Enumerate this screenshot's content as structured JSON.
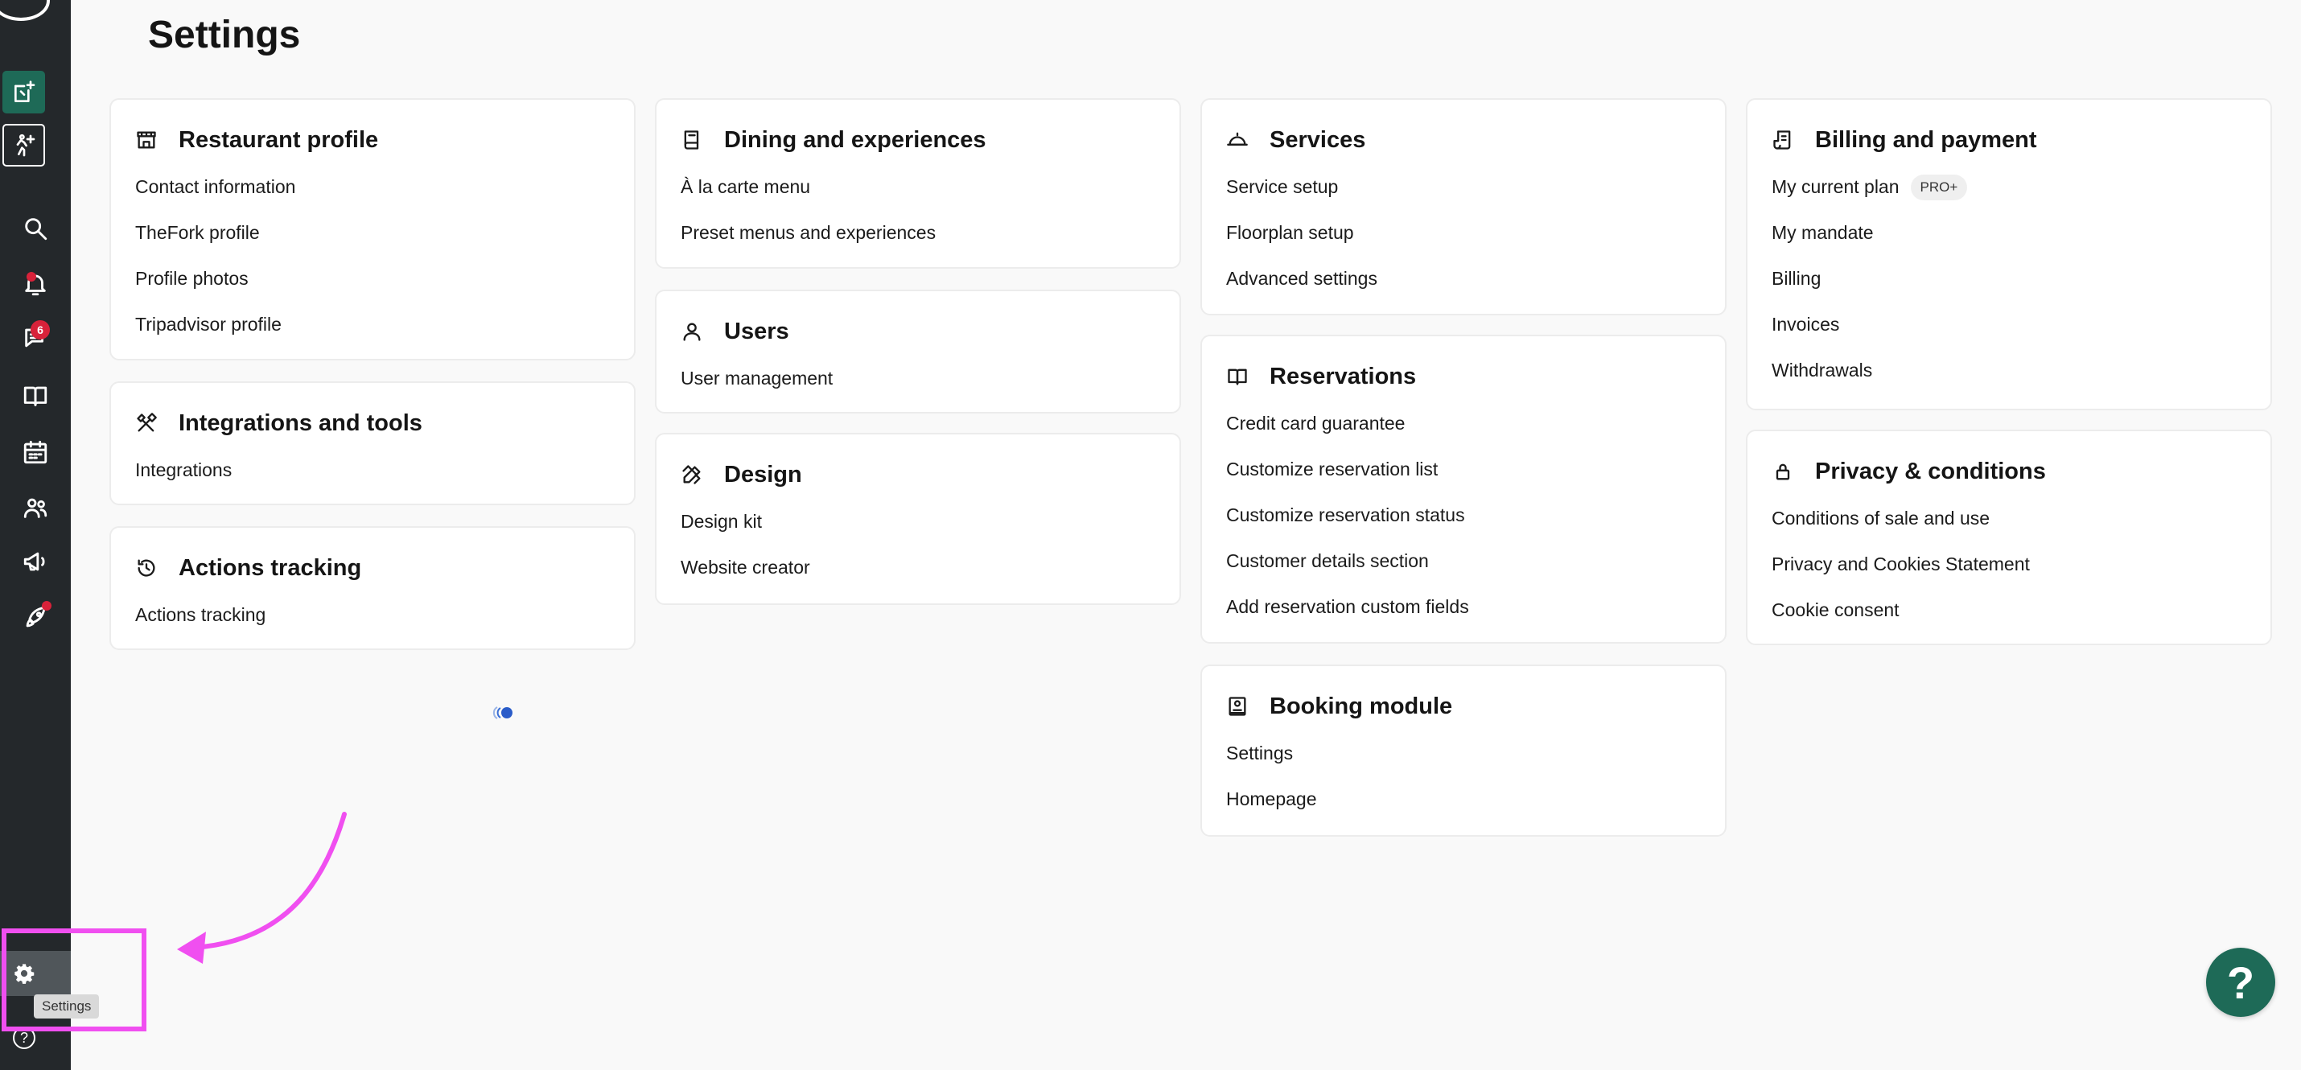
{
  "page": {
    "title": "Settings"
  },
  "sidebar": {
    "unread_messages": "6",
    "settings_tooltip": "Settings",
    "help_glyph": "?"
  },
  "cards": {
    "restaurant_profile": {
      "title": "Restaurant profile",
      "links": [
        "Contact information",
        "TheFork profile",
        "Profile photos",
        "Tripadvisor profile"
      ]
    },
    "integrations_tools": {
      "title": "Integrations and tools",
      "links": [
        "Integrations"
      ]
    },
    "actions_tracking": {
      "title": "Actions tracking",
      "links": [
        "Actions tracking"
      ]
    },
    "dining": {
      "title": "Dining and experiences",
      "links": [
        "À la carte menu",
        "Preset menus and experiences"
      ]
    },
    "users": {
      "title": "Users",
      "links": [
        "User management"
      ]
    },
    "design": {
      "title": "Design",
      "links": [
        "Design kit",
        "Website creator"
      ]
    },
    "services": {
      "title": "Services",
      "links": [
        "Service setup",
        "Floorplan setup",
        "Advanced settings"
      ]
    },
    "reservations": {
      "title": "Reservations",
      "links": [
        "Credit card guarantee",
        "Customize reservation list",
        "Customize reservation status",
        "Customer details section",
        "Add reservation custom fields"
      ]
    },
    "booking_module": {
      "title": "Booking module",
      "links": [
        "Settings",
        "Homepage"
      ]
    },
    "billing": {
      "title": "Billing and payment",
      "links": [
        "My current plan",
        "My mandate",
        "Billing",
        "Invoices",
        "Withdrawals"
      ],
      "plan_badge": "PRO+"
    },
    "privacy": {
      "title": "Privacy & conditions",
      "links": [
        "Conditions of sale and use",
        "Privacy and Cookies Statement",
        "Cookie consent"
      ]
    }
  },
  "help_fab": {
    "label": "?"
  },
  "colors": {
    "sidebar_bg": "#24282b",
    "brand_green": "#1e6a57",
    "notification_red": "#d8223a",
    "annotation_magenta": "#f04ff0",
    "page_bg": "#f9f9f9"
  }
}
